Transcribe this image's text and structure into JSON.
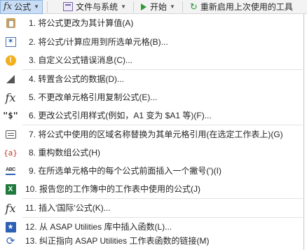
{
  "toolbar": {
    "formula_label": "公式",
    "files_label": "文件与系统",
    "start_label": "开始",
    "rerun_label": "重新启用上次使用的工具"
  },
  "menu": {
    "items": [
      {
        "label": "1. 将公式更改为其计算值(A)",
        "icon": "paste-values-icon"
      },
      {
        "label": "2. 将公式/计算应用到所选单元格(B)...",
        "icon": "apply-formula-icon"
      },
      {
        "label": "3. 自定义公式错误消息(C)...",
        "icon": "warning-icon"
      },
      {
        "label": "4. 转置含公式的数据(D)...",
        "icon": "transpose-icon"
      },
      {
        "label": "5. 不更改单元格引用复制公式(E)...",
        "icon": "fx-icon"
      },
      {
        "label": "6. 更改公式引用样式(例如，A1 变为 $A1 等)(F)...",
        "icon": "dollar-reference-icon"
      },
      {
        "label": "7. 将公式中使用的区域名称替换为其单元格引用(在选定工作表上)(G)",
        "icon": "name-replace-icon"
      },
      {
        "label": "8. 重构数组公式(H)",
        "icon": "array-formula-icon"
      },
      {
        "label": "9. 在所选单元格中的每个公式前面插入一个撇号(')(I)",
        "icon": "abc-apostrophe-icon"
      },
      {
        "label": "10. 报告您的工作簿中的工作表中使用的公式(J)",
        "icon": "excel-report-icon"
      },
      {
        "label": "11. 插入'国际'公式(K)...",
        "icon": "fx-international-icon"
      },
      {
        "label": "12. 从 ASAP Utilities 库中插入函数(L)...",
        "icon": "insert-function-icon"
      },
      {
        "label": "13. 纠正指向 ASAP Utilities 工作表函数的链接(M)",
        "icon": "sync-links-icon"
      }
    ]
  }
}
